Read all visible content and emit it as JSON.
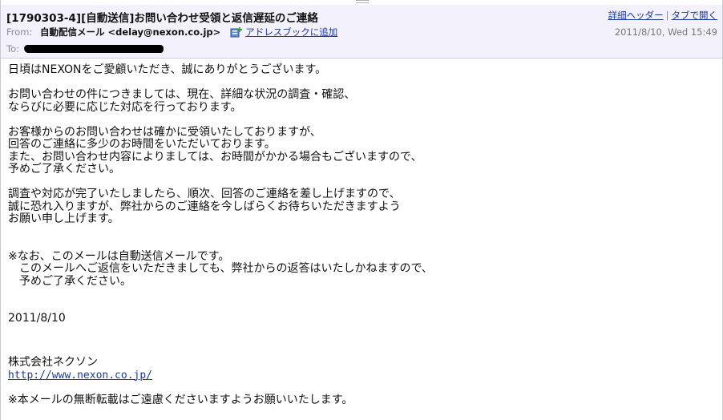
{
  "header": {
    "subject": "[1790303-4][自動送信]お問い合わせ受領と返信遅延のご連絡",
    "links": {
      "detail_header": "詳細ヘッダー",
      "open_in_tab": "タブで開く"
    },
    "from_label": "From:",
    "from_value": "自動配信メール <delay@nexon.co.jp>",
    "add_addressbook": "アドレスブックに追加",
    "date": "2011/8/10, Wed 15:49",
    "to_label": "To:"
  },
  "body": {
    "greeting": "日頃はNEXONをご愛顧いただき、誠にありがとうございます。",
    "para1": [
      "お問い合わせの件につきましては、現在、詳細な状況の調査・確認、",
      "ならびに必要に応じた対応を行っております。"
    ],
    "para2": [
      "お客様からのお問い合わせは確かに受領いたしておりますが、",
      "回答のご連絡に多少のお時間をいただいております。",
      "また、お問い合わせ内容によりましては、お時間がかかる場合もございますので、",
      "予めご了承ください。"
    ],
    "para3": [
      "調査や対応が完了いたしましたら、順次、回答のご連絡を差し上げますので、",
      "誠に恐れ入りますが、弊社からのご連絡を今しばらくお待ちいただきますよう",
      "お願い申し上げます。"
    ],
    "note": [
      "※なお、このメールは自動送信メールです。",
      "　このメールへご返信をいただきましても、弊社からの返答はいたしかねますので、",
      "　予めご了承ください。"
    ],
    "date": "2011/8/10",
    "company": "株式会社ネクソン",
    "url": "http://www.nexon.co.jp/",
    "footer": "※本メールの無断転載はご遠慮くださいますようお願いいたします。"
  },
  "colors": {
    "header_bg": "#f3f1fb",
    "link": "#1a3a9c"
  },
  "icons": {
    "add_addressbook": "addressbook-add-icon"
  }
}
